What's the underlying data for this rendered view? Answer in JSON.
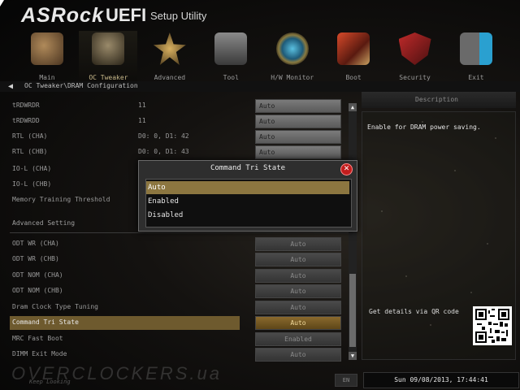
{
  "header": {
    "brand": "ASRock",
    "product": "UEFI",
    "subtitle": "Setup Utility"
  },
  "tabs": [
    {
      "label": "Main",
      "icon": "main-icon",
      "color": "#7a5a3a"
    },
    {
      "label": "OC Tweaker",
      "icon": "rocket-icon",
      "color": "#5a4a30",
      "active": true
    },
    {
      "label": "Advanced",
      "icon": "star-icon",
      "color": "#8a6e3a"
    },
    {
      "label": "Tool",
      "icon": "toolbox-icon",
      "color": "#555555"
    },
    {
      "label": "H/W Monitor",
      "icon": "monitor-icon",
      "color": "#1e5a78"
    },
    {
      "label": "Boot",
      "icon": "boot-icon",
      "color": "#8a2a1e"
    },
    {
      "label": "Security",
      "icon": "shield-icon",
      "color": "#7a2020"
    },
    {
      "label": "Exit",
      "icon": "exit-icon",
      "color": "#1e6a8a"
    }
  ],
  "breadcrumb": "OC Tweaker\\DRAM Configuration",
  "settings": [
    {
      "name": "tRDWRDR",
      "value": "11",
      "control": "Auto"
    },
    {
      "name": "tRDWRDD",
      "value": "11",
      "control": "Auto"
    },
    {
      "name": "RTL (CHA)",
      "value": "D0: 0, D1: 42",
      "control": "Auto"
    },
    {
      "name": "RTL (CHB)",
      "value": "D0: 0, D1: 43",
      "control": "Auto"
    },
    {
      "name": "IO-L (CHA)",
      "value": "",
      "control": ""
    },
    {
      "name": "IO-L (CHB)",
      "value": "",
      "control": ""
    },
    {
      "name": "Memory Training Threshold",
      "value": "",
      "control": ""
    },
    {
      "name": "Advanced Setting",
      "value": "",
      "control": ""
    },
    {
      "name": "ODT WR (CHA)",
      "value": "",
      "control": "Auto"
    },
    {
      "name": "ODT WR (CHB)",
      "value": "",
      "control": "Auto"
    },
    {
      "name": "ODT NOM (CHA)",
      "value": "",
      "control": "Auto"
    },
    {
      "name": "ODT NOM (CHB)",
      "value": "",
      "control": "Auto"
    },
    {
      "name": "Dram Clock Type Tuning",
      "value": "",
      "control": "Auto"
    },
    {
      "name": "Command Tri State",
      "value": "",
      "control": "Auto"
    },
    {
      "name": "MRC Fast Boot",
      "value": "",
      "control": "Enabled"
    },
    {
      "name": "DIMM Exit Mode",
      "value": "",
      "control": "Auto"
    }
  ],
  "description": {
    "title": "Description",
    "text": "Enable for DRAM power saving.",
    "qr_label": "Get details via QR code"
  },
  "modal": {
    "title": "Command Tri State",
    "options": [
      "Auto",
      "Enabled",
      "Disabled"
    ],
    "selected": "Auto"
  },
  "footer": {
    "watermark": "OVERCLOCKERS.ua",
    "tagline": "Keep Looking",
    "lang": "EN",
    "datetime": "Sun 09/08/2013, 17:44:41"
  }
}
